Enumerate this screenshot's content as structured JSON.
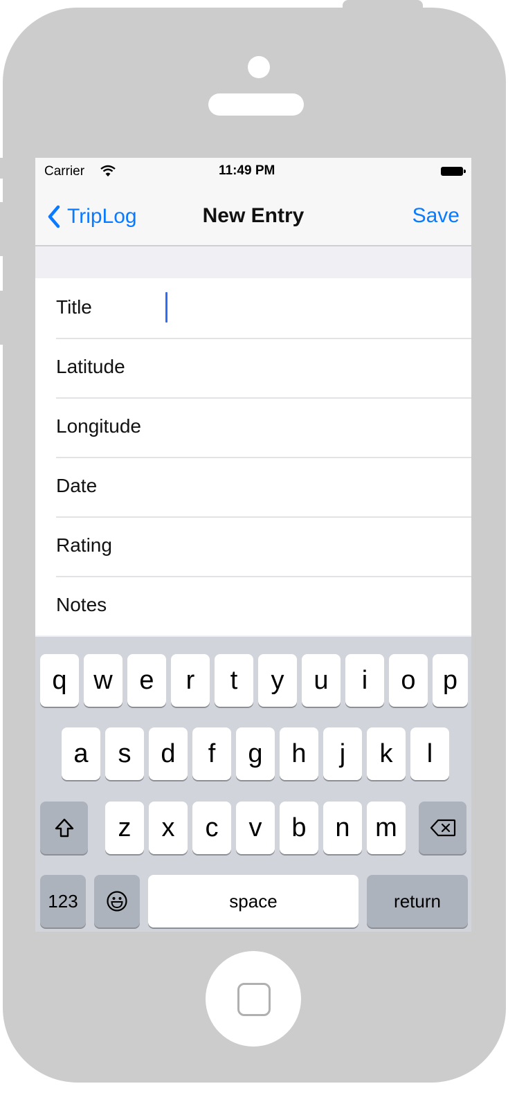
{
  "status_bar": {
    "carrier": "Carrier",
    "time": "11:49 PM"
  },
  "nav": {
    "back_label": "TripLog",
    "title": "New Entry",
    "save_label": "Save"
  },
  "form": {
    "fields": [
      {
        "label": "Title",
        "active": true
      },
      {
        "label": "Latitude"
      },
      {
        "label": "Longitude"
      },
      {
        "label": "Date"
      },
      {
        "label": "Rating"
      },
      {
        "label": "Notes"
      }
    ]
  },
  "keyboard": {
    "row1": [
      "q",
      "w",
      "e",
      "r",
      "t",
      "y",
      "u",
      "i",
      "o",
      "p"
    ],
    "row2": [
      "a",
      "s",
      "d",
      "f",
      "g",
      "h",
      "j",
      "k",
      "l"
    ],
    "row3": [
      "z",
      "x",
      "c",
      "v",
      "b",
      "n",
      "m"
    ],
    "numbers_label": "123",
    "space_label": "space",
    "return_label": "return",
    "shift_icon": "shift-icon",
    "emoji_icon": "emoji-icon",
    "delete_icon": "delete-icon"
  },
  "colors": {
    "accent": "#0a7aff",
    "caret": "#2d6cf6",
    "device": "#cccccc"
  }
}
